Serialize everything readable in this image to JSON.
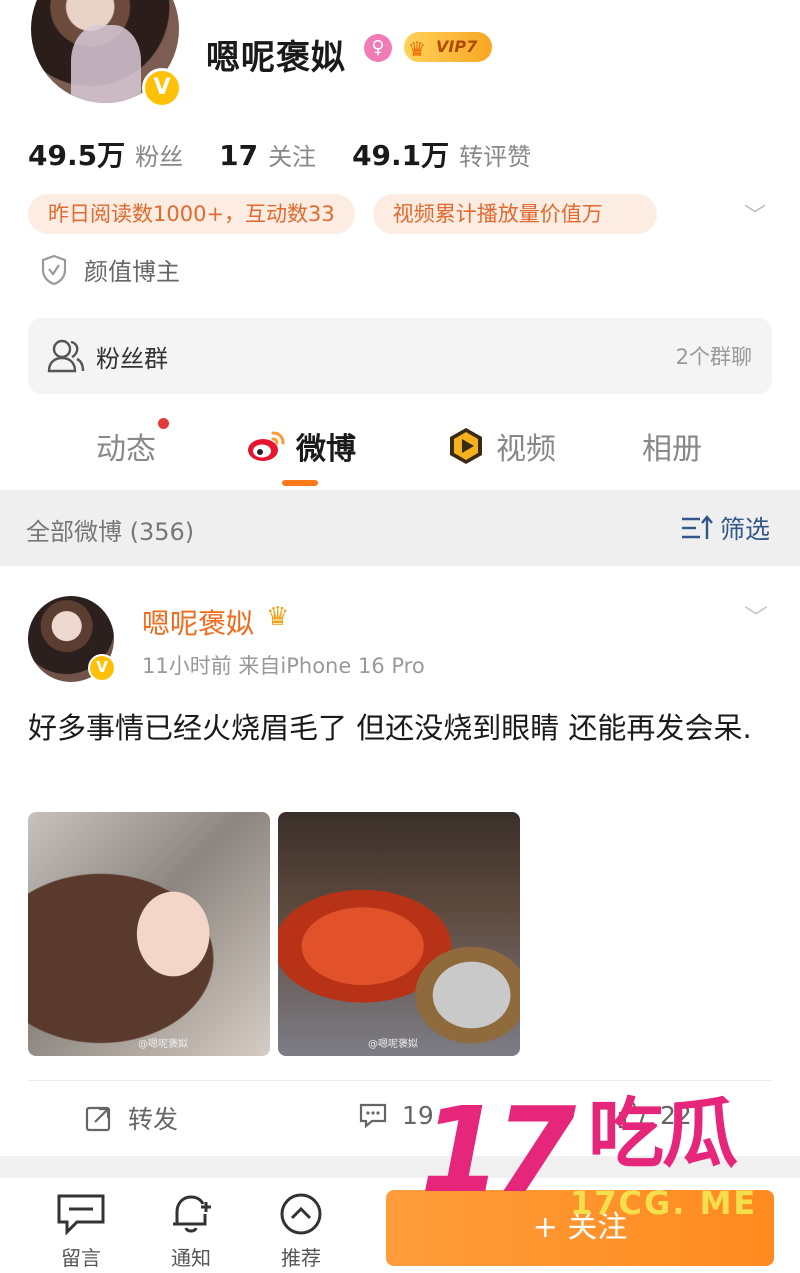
{
  "profile": {
    "nickname": "嗯呢褒姒",
    "gender_symbol": "♀",
    "vip_label": "VIP7",
    "stats": [
      {
        "num": "49.5万",
        "label": "粉丝"
      },
      {
        "num": "17",
        "label": "关注"
      },
      {
        "num": "49.1万",
        "label": "转评赞"
      }
    ],
    "tags": [
      "昨日阅读数1000+，互动数33",
      "视频累计播放量价值万"
    ],
    "blogger_type": "颜值博主"
  },
  "fan_group": {
    "label": "粉丝群",
    "count": "2个群聊"
  },
  "tabs": [
    {
      "label": "动态"
    },
    {
      "label": "微博"
    },
    {
      "label": "视频"
    },
    {
      "label": "相册"
    }
  ],
  "filter": {
    "all_posts": "全部微博 (356)",
    "filter_label": "筛选"
  },
  "post": {
    "author": "嗯呢褒姒",
    "meta": "11小时前  来自iPhone 16 Pro",
    "text": "好多事情已经火烧眉毛了 但还没烧到眼睛 还能再发会呆.",
    "photo_watermark": "@嗯呢褒姒",
    "actions": {
      "repost": "转发",
      "comment": "19",
      "like": "22"
    }
  },
  "bottom_bar": {
    "message": "留言",
    "notify": "通知",
    "recommend": "推荐",
    "follow": "+ 关注"
  },
  "overlay": {
    "big_number": "17",
    "brand": "吃瓜",
    "domain": "17CG. ME"
  },
  "colors": {
    "accent_orange": "#ff8a1f",
    "name_orange": "#f26a1a",
    "link_blue": "#34578a",
    "watermark_pink": "#e6267a"
  }
}
